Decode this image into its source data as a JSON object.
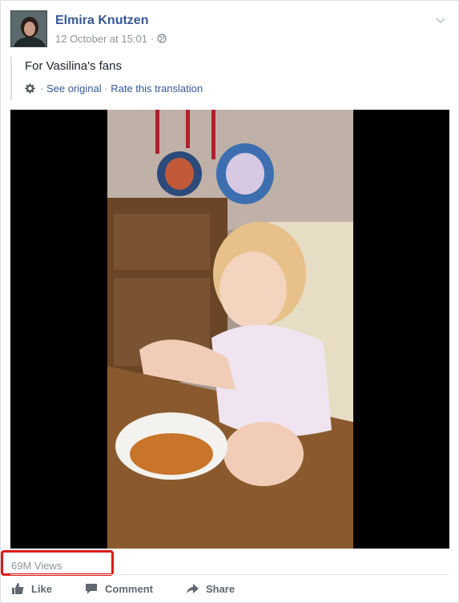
{
  "post": {
    "author": "Elmira Knutzen",
    "timestamp": "12 October at 15:01",
    "audience_icon": "globe-icon",
    "message": "For Vasilina's fans",
    "see_original": "See original",
    "rate_translation": "Rate this translation",
    "separator": "·"
  },
  "video": {
    "views": "69M Views"
  },
  "actions": {
    "like": "Like",
    "comment": "Comment",
    "share": "Share"
  },
  "colors": {
    "link": "#365899",
    "muted": "#90949c",
    "highlight": "#e01a1a"
  }
}
